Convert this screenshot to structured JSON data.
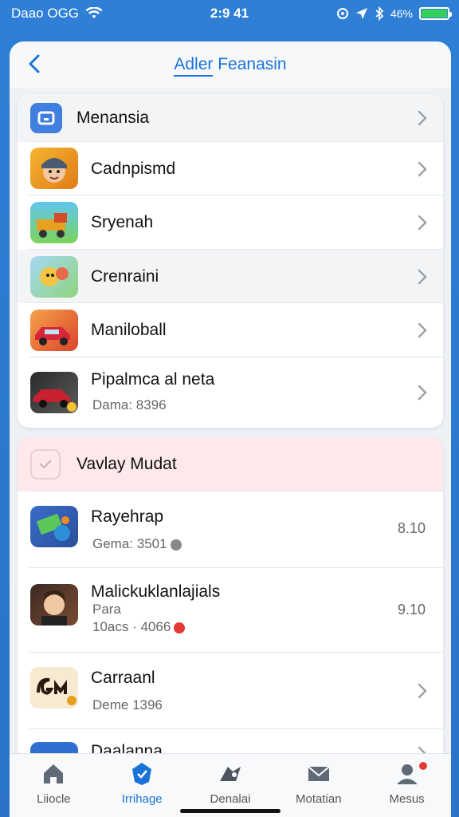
{
  "status": {
    "carrier": "Daao OGG",
    "time": "2:9 41",
    "right_text": "46%"
  },
  "header": {
    "title_part1": "Adler",
    "title_part2": " Feanasin"
  },
  "card1": {
    "header_label": "Menansia",
    "items": [
      {
        "title": "Cadnpismd",
        "sub": ""
      },
      {
        "title": "Sryenah",
        "sub": ""
      },
      {
        "title": "Crenraini",
        "sub": ""
      },
      {
        "title": "Maniloball",
        "sub": ""
      },
      {
        "title": "Pipalmca al neta",
        "sub": "Dama: 8396"
      }
    ]
  },
  "card2": {
    "header_label": "Vavlay Mudat",
    "items": [
      {
        "title": "Rayehrap",
        "sub": "Gema: 3501",
        "value": "8.10"
      },
      {
        "title": "Malickuklanlajials",
        "sub1": "Para",
        "sub": "10acs · 4066",
        "value": "9.10"
      },
      {
        "title": "Carraanl",
        "sub": "Deme 1396",
        "value": ""
      },
      {
        "title": "Daalanna",
        "sub": "",
        "value": ""
      }
    ]
  },
  "tabs": [
    {
      "label": "Liiocle",
      "icon": "home-icon"
    },
    {
      "label": "Irrihage",
      "icon": "shield-icon"
    },
    {
      "label": "Denalai",
      "icon": "game-icon"
    },
    {
      "label": "Motatian",
      "icon": "inbox-icon"
    },
    {
      "label": "Mesus",
      "icon": "profile-icon"
    }
  ],
  "colors": {
    "accent": "#1a73d9",
    "background": "#2f7fd6",
    "badge": "#e53935",
    "battery": "#36d15d"
  }
}
